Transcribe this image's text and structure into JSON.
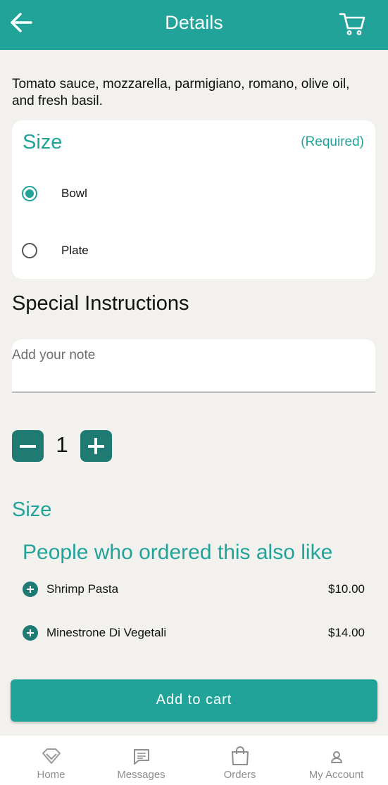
{
  "header": {
    "title": "Details",
    "back_icon": "arrow-left-icon",
    "cart_icon": "cart-icon"
  },
  "item": {
    "description": "Tomato sauce, mozzarella, parmigiano, romano, olive oil, and fresh basil."
  },
  "size_card": {
    "title": "Size",
    "required": "(Required)",
    "options": [
      {
        "label": "Bowl",
        "selected": true
      },
      {
        "label": "Plate",
        "selected": false
      }
    ]
  },
  "special_instructions": {
    "title": "Special Instructions",
    "placeholder": "Add your note",
    "value": ""
  },
  "quantity": {
    "value": "1"
  },
  "size_section": {
    "title": "Size"
  },
  "upsell": {
    "title": "People who ordered this also like",
    "items": [
      {
        "name": "Shrimp Pasta",
        "price": "$10.00"
      },
      {
        "name": "Minestrone Di Vegetali",
        "price": "$14.00"
      }
    ]
  },
  "add_to_cart": {
    "label": "Add to cart"
  },
  "bottom_nav": {
    "items": [
      {
        "label": "Home",
        "icon": "home-icon"
      },
      {
        "label": "Messages",
        "icon": "messages-icon"
      },
      {
        "label": "Orders",
        "icon": "shopping-bag-icon"
      },
      {
        "label": "My Account",
        "icon": "account-icon"
      }
    ]
  },
  "colors": {
    "primary": "#22a39a",
    "primary_dark": "#1e7a72",
    "background": "#f3f1ee"
  }
}
